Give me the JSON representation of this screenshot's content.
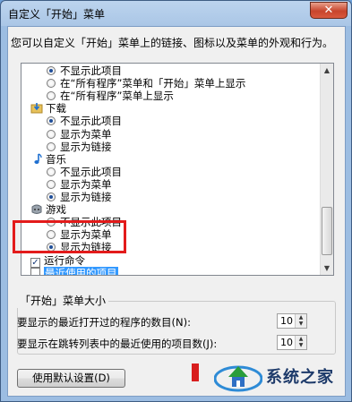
{
  "window": {
    "title": "自定义「开始」菜单",
    "close_label": "✕"
  },
  "description": "您可以自定义「开始」菜单上的链接、图标以及菜单的外观和行为。",
  "list": {
    "rows": [
      {
        "kind": "radio",
        "label": "不显示此项目",
        "checked": true
      },
      {
        "kind": "radio",
        "label": "在“所有程序”菜单和「开始」菜单上显示",
        "checked": false
      },
      {
        "kind": "radio",
        "label": "在“所有程序”菜单上显示",
        "checked": false
      },
      {
        "kind": "category",
        "label": "下载",
        "icon": "download-folder-icon"
      },
      {
        "kind": "radio",
        "label": "不显示此项目",
        "checked": true
      },
      {
        "kind": "radio",
        "label": "显示为菜单",
        "checked": false
      },
      {
        "kind": "radio",
        "label": "显示为链接",
        "checked": false
      },
      {
        "kind": "category",
        "label": "音乐",
        "icon": "music-note-icon"
      },
      {
        "kind": "radio",
        "label": "不显示此项目",
        "checked": false
      },
      {
        "kind": "radio",
        "label": "显示为菜单",
        "checked": false
      },
      {
        "kind": "radio",
        "label": "显示为链接",
        "checked": true
      },
      {
        "kind": "category",
        "label": "游戏",
        "icon": "games-icon"
      },
      {
        "kind": "radio",
        "label": "不显示此项目",
        "checked": false
      },
      {
        "kind": "radio",
        "label": "显示为菜单",
        "checked": false
      },
      {
        "kind": "radio",
        "label": "显示为链接",
        "checked": true
      },
      {
        "kind": "checkbox",
        "label": "运行命令",
        "checked": true,
        "selected": false
      },
      {
        "kind": "checkbox",
        "label": "最近使用的项目",
        "checked": false,
        "selected": true
      }
    ]
  },
  "size_group": {
    "title": "「开始」菜单大小",
    "recent_programs_label": "要显示的最近打开过的程序的数目(N):",
    "recent_programs_value": "10",
    "jumplist_items_label": "要显示在跳转列表中的最近使用的项目数(J):",
    "jumplist_items_value": "10"
  },
  "buttons": {
    "defaults_label": "使用默认设置(D)"
  },
  "watermark": {
    "text": "系统之家"
  },
  "colors": {
    "highlight": "#3399ff",
    "annotation": "#e31b1b"
  }
}
